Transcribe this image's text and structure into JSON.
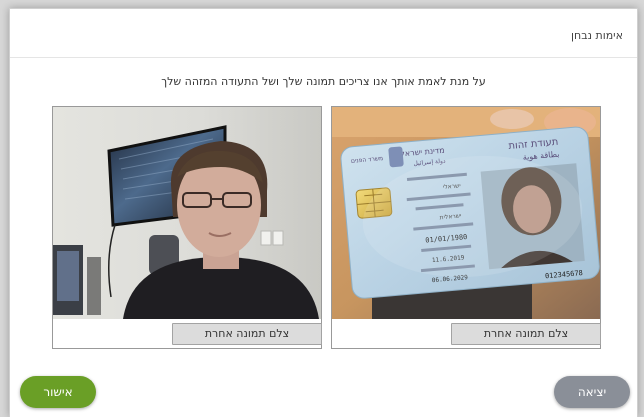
{
  "dialog": {
    "title": "אימות נבחן",
    "instruction": "על מנת לאמת אותך אנו צריכים תמונה שלך ושל התעודה המזהה שלך"
  },
  "id_photo": {
    "retake_label": "צלם תמונה אחרת",
    "card": {
      "header_right": "תעודת זהות",
      "header_right_sub": "بطاقة هوية",
      "header_center": "מדינת ישראל",
      "header_center_sub": "دولة إسرائيل",
      "header_left": "משרד הפנים",
      "nationality": "ישראלי",
      "birth_country": "ישראלית",
      "birth_date": "01/01/1980",
      "issue_date": "11.6.2019",
      "expiry_date": "06.06.2029",
      "id_number": "012345678"
    }
  },
  "selfie_photo": {
    "retake_label": "צלם תמונה אחרת"
  },
  "footer": {
    "exit_label": "יציאה",
    "confirm_label": "אישור"
  },
  "colors": {
    "confirm": "#6a9f26",
    "exit": "#8a8f98"
  }
}
